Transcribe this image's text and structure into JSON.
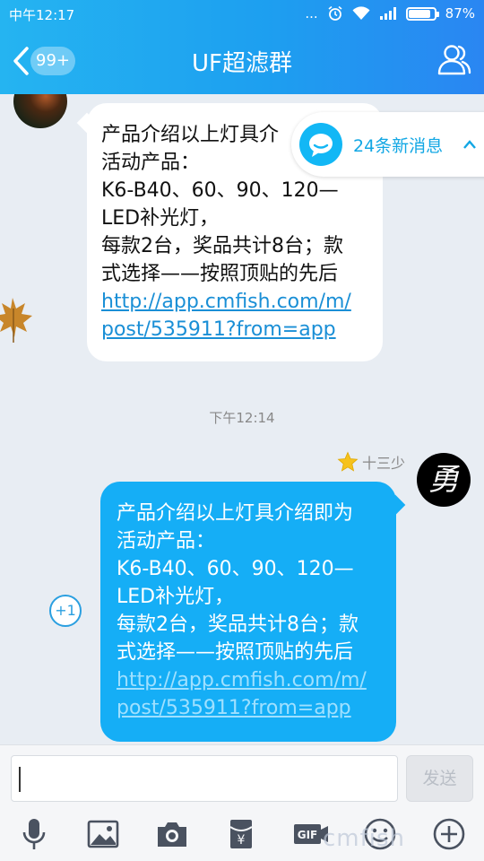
{
  "status_bar": {
    "carrier_time": "中午12:17",
    "dots": "...",
    "battery_text": "87%",
    "battery_level": 0.87
  },
  "header": {
    "back_badge": "99+",
    "title": "UF超滤群"
  },
  "messages": [
    {
      "lines": [
        "产品介绍以上灯具介",
        "活动产品：",
        "K6-B40、60、90、120—",
        "LED补光灯，",
        "每款2台，奖品共计8台；款",
        "式选择——按照顶贴的先后"
      ],
      "link_lines": [
        "http://app.cmfish.com/m/",
        "post/535911?from=app"
      ]
    },
    {
      "sender": "十三少",
      "avatar_char": "勇",
      "lines": [
        "产品介绍以上灯具介绍即为",
        "活动产品：",
        "K6-B40、60、90、120—",
        "LED补光灯，",
        "每款2台，奖品共计8台；款",
        "式选择——按照顶贴的先后"
      ],
      "link_lines": [
        "http://app.cmfish.com/m/",
        "post/535911?from=app"
      ]
    }
  ],
  "new_messages": {
    "label": "24条新消息"
  },
  "timestamp": "下午12:14",
  "plus_one": "+1",
  "input": {
    "placeholder": "",
    "send_label": "发送"
  },
  "watermark": "cmfish",
  "icons": [
    "mic-icon",
    "image-icon",
    "camera-icon",
    "red-packet-icon",
    "gif-icon",
    "emoji-icon",
    "plus-icon"
  ],
  "colors": {
    "header": "#1d9ff0",
    "bubble_out": "#15aef6",
    "link": "#1a8fd6"
  }
}
